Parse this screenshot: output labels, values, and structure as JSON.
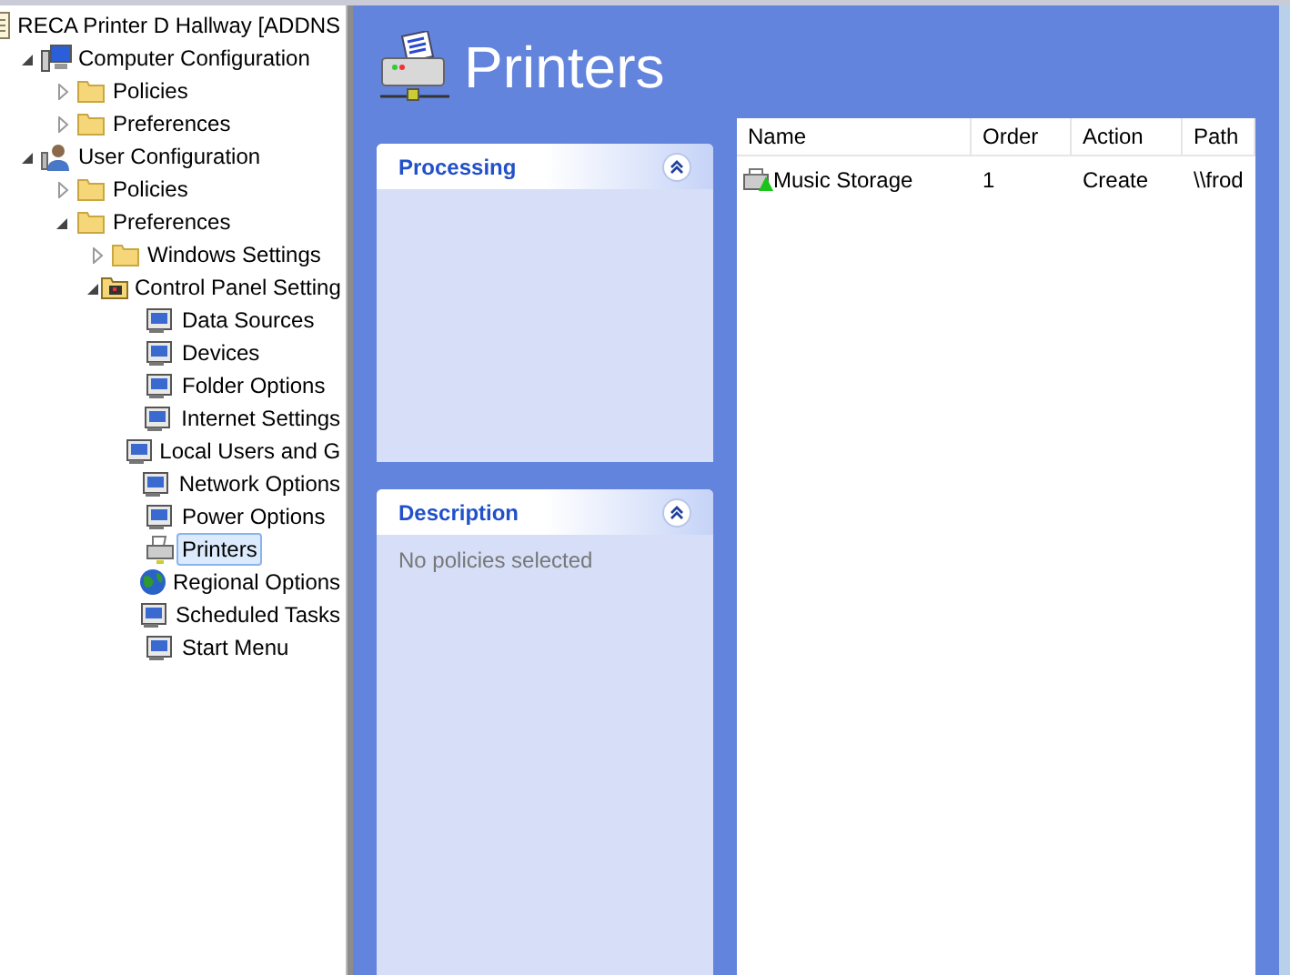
{
  "tree": [
    {
      "label": "RECA Printer D Hallway [ADDNS",
      "kind": "document",
      "children": [
        {
          "label": "Computer Configuration",
          "kind": "computer",
          "expanded": true,
          "children": [
            {
              "label": "Policies",
              "kind": "folder",
              "expanded": false
            },
            {
              "label": "Preferences",
              "kind": "folder",
              "expanded": false
            }
          ]
        },
        {
          "label": "User Configuration",
          "kind": "user",
          "expanded": true,
          "children": [
            {
              "label": "Policies",
              "kind": "folder",
              "expanded": false
            },
            {
              "label": "Preferences",
              "kind": "folder",
              "expanded": true,
              "children": [
                {
                  "label": "Windows Settings",
                  "kind": "folder",
                  "expanded": false
                },
                {
                  "label": "Control Panel Setting",
                  "kind": "control-panel",
                  "expanded": true,
                  "children": [
                    {
                      "label": "Data Sources",
                      "kind": "item",
                      "selected": false
                    },
                    {
                      "label": "Devices",
                      "kind": "item",
                      "selected": false
                    },
                    {
                      "label": "Folder Options",
                      "kind": "item",
                      "selected": false
                    },
                    {
                      "label": "Internet Settings",
                      "kind": "item",
                      "selected": false
                    },
                    {
                      "label": "Local Users and G",
                      "kind": "item",
                      "selected": false
                    },
                    {
                      "label": "Network Options",
                      "kind": "item",
                      "selected": false
                    },
                    {
                      "label": "Power Options",
                      "kind": "item",
                      "selected": false
                    },
                    {
                      "label": "Printers",
                      "kind": "printer",
                      "selected": true
                    },
                    {
                      "label": "Regional Options",
                      "kind": "globe",
                      "selected": false
                    },
                    {
                      "label": "Scheduled Tasks",
                      "kind": "item",
                      "selected": false
                    },
                    {
                      "label": "Start Menu",
                      "kind": "item",
                      "selected": false
                    }
                  ]
                }
              ]
            }
          ]
        }
      ]
    }
  ],
  "header": {
    "title": "Printers"
  },
  "panels": [
    {
      "title": "Processing",
      "expanded": true
    },
    {
      "title": "Description",
      "expanded": true,
      "text": "No policies selected"
    }
  ],
  "table": {
    "columns": [
      "Name",
      "Order",
      "Action",
      "Path"
    ],
    "rows": [
      [
        "Music Storage",
        "1",
        "Create",
        "\\\\frod"
      ]
    ]
  }
}
